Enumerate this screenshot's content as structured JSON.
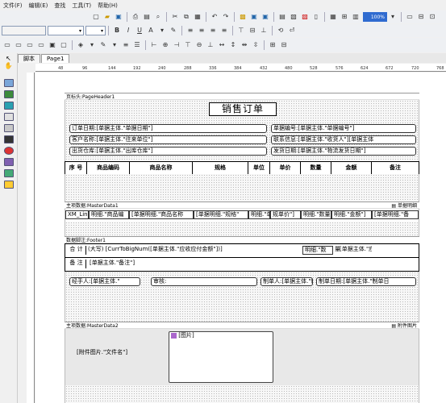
{
  "menu": [
    "文件(F)",
    "编辑(E)",
    "查找",
    "工具(T)",
    "帮助(H)"
  ],
  "toolbar": {
    "zoom": "100%"
  },
  "tabs": [
    "脚本",
    "Page1"
  ],
  "ruler_marks": [
    "48",
    "96",
    "144",
    "192",
    "240",
    "288",
    "336",
    "384",
    "432",
    "480",
    "528",
    "576",
    "624",
    "672",
    "720",
    "768"
  ],
  "report": {
    "page_header_label": "页标头:PageHeader1",
    "title": "销售订单",
    "order_date": "订单日期:[单据主体.\"单据日期\"]",
    "order_no": "单据编号:[单据主体.\"单据编号\"]",
    "customer": "客户名称:[单据主体.\"往来单位\"]",
    "contact": "联系信息:[单据主体.\"收货人\"][单据主体",
    "warehouse": "出货仓库:[单据主体.\"出库仓库\"]",
    "ship_date": "发货日期:[单据主体.\"物流发货日期\"]",
    "columns": [
      "序 号",
      "商品编码",
      "商品名称",
      "规格",
      "单位",
      "单价",
      "数量",
      "金额",
      "备注"
    ],
    "master1_label": "主项数据:MasterData1",
    "master1_tag": "单据明细",
    "row_cells": [
      "XM_Lin",
      "明细.\"商品编",
      "[单据明细.\"商品名称",
      "[单据明细.\"规格\"",
      "明细.\"单",
      "规单价\"]",
      "明细.\"数量",
      "明细.\"金额\"]",
      "[单据明细.\"备"
    ],
    "footer_label": "数据脚注:Footer1",
    "total_label": "合  计",
    "total_value": "(大写) [CurrToBigNum([单据主体.\"应收应付金额\"])]",
    "total_cell1": "明细.\"数",
    "total_cell2": "量\"]",
    "total_cell3": "[单据主体.\"应收应付金额\"]",
    "remark_label": "备  注",
    "remark_value": "[单据主体.\"备注\"]",
    "handler": "经手人:[单据主体.\"",
    "auditor": "审核:",
    "maker": "制单人:[单据主体.\"制单",
    "make_date": "制单日期:[单据主体.\"制单日",
    "master2_label": "主项数据:MasterData2",
    "master2_tag": "附件图片",
    "attach_field": "[附件图片.\"文件名\"]",
    "picture_label": "[图片]"
  }
}
